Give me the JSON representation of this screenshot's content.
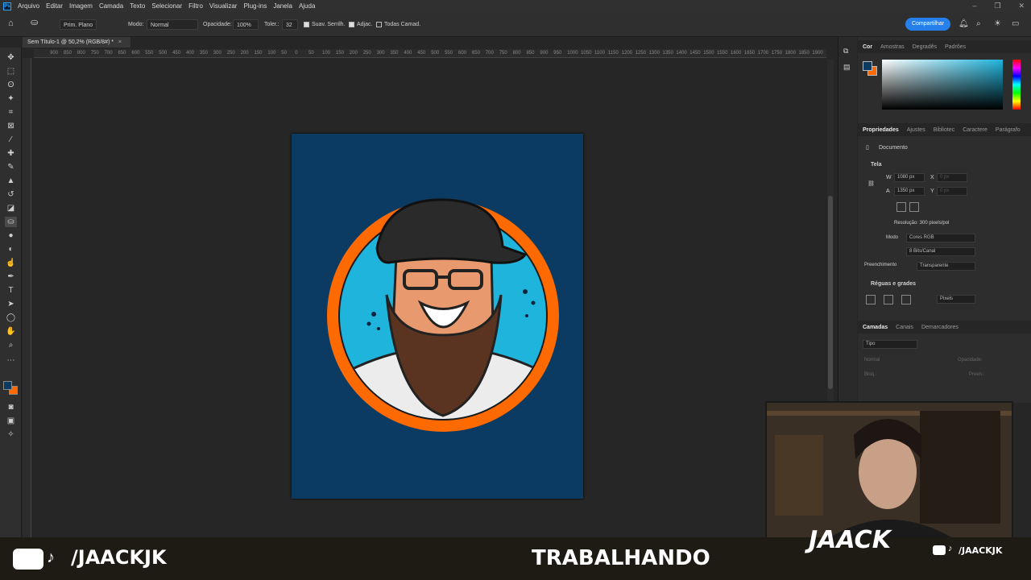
{
  "app": {
    "logo": "Ps"
  },
  "menu": [
    "Arquivo",
    "Editar",
    "Imagem",
    "Camada",
    "Texto",
    "Selecionar",
    "Filtro",
    "Visualizar",
    "Plug-ins",
    "Janela",
    "Ajuda"
  ],
  "options": {
    "brush_label": "Prim. Plano",
    "mode_label": "Modo:",
    "mode_value": "Normal",
    "opacity_label": "Opacidade:",
    "opacity_value": "100%",
    "tolerance_label": "Toler.:",
    "tolerance_value": "32",
    "antialias": "Suav. Serrilh.",
    "contiguous": "Adjac.",
    "all_layers": "Todas Camad.",
    "share": "Compartilhar"
  },
  "document": {
    "tab_title": "Sem Título-1 @ 50,2% (RGB/8#) *",
    "close": "×"
  },
  "ruler_ticks": [
    "900",
    "850",
    "800",
    "750",
    "700",
    "650",
    "600",
    "550",
    "500",
    "450",
    "400",
    "350",
    "300",
    "250",
    "200",
    "150",
    "100",
    "50",
    "0",
    "50",
    "100",
    "150",
    "200",
    "250",
    "300",
    "350",
    "400",
    "450",
    "500",
    "550",
    "600",
    "650",
    "700",
    "750",
    "800",
    "850",
    "900",
    "950",
    "1000",
    "1050",
    "1100",
    "1150",
    "1200",
    "1250",
    "1300",
    "1350",
    "1400",
    "1450",
    "1500",
    "1550",
    "1600",
    "1650",
    "1700",
    "1750",
    "1800",
    "1850",
    "1900"
  ],
  "color_panel": {
    "tabs": [
      "Cor",
      "Amostras",
      "Degradês",
      "Padrões"
    ],
    "fg": "#0b3a63",
    "bg": "#ff6a00"
  },
  "properties": {
    "tabs": [
      "Propriedades",
      "Ajustes",
      "Bibliotec",
      "Caractere",
      "Parágrafo"
    ],
    "document_label": "Documento",
    "section_canvas": "Tela",
    "w_label": "W",
    "w_value": "1080 px",
    "h_label": "A",
    "h_value": "1350 px",
    "x_label": "X",
    "x_value": "0 px",
    "y_label": "Y",
    "y_value": "0 px",
    "resolution": "Resolução: 300 pixels/pol",
    "mode_label": "Modo",
    "mode_value": "Cores RGB",
    "bits_value": "8 Bits/Canal",
    "fill_label": "Preenchimento",
    "fill_value": "Transparente",
    "section_rulers": "Réguas e grades",
    "units_value": "Pixels"
  },
  "layers": {
    "tabs": [
      "Camadas",
      "Canais",
      "Demarcadores"
    ],
    "filter_value": "Tipo",
    "blend_value": "Normal",
    "opacity_label": "Opacidade:",
    "opacity_value": "100%",
    "lock_label": "Bloq.:",
    "fill_label": "Preen.:",
    "fill_value": "100%"
  },
  "stream": {
    "handle_left": "/JAACKJK",
    "status": "TRABALHANDO",
    "logo_text": "JAACK",
    "handle_right": "/JAACKJK"
  }
}
